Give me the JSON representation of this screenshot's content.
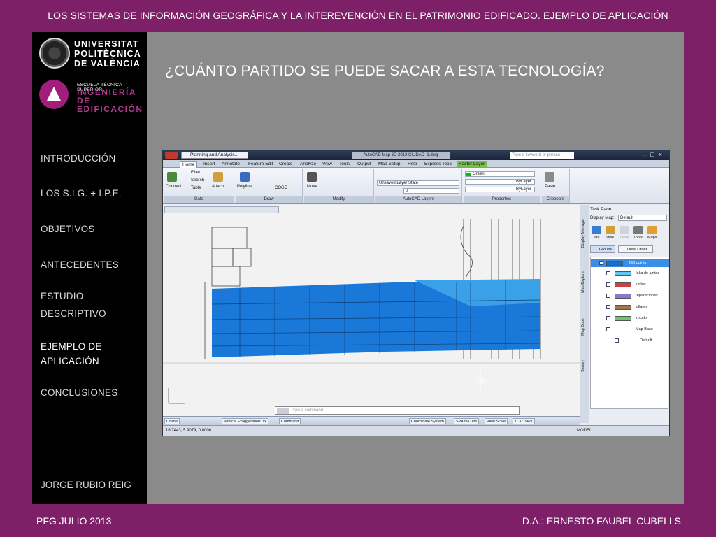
{
  "header": {
    "title": "LOS SISTEMAS DE INFORMACIÓN GEOGRÁFICA Y LA INTEREVENCIÓN EN EL PATRIMONIO EDIFICADO. EJEMPLO DE APLICACIÓN"
  },
  "footer": {
    "left": "PFG JULIO 2013",
    "right": "D.A.: ERNESTO FAUBEL CUBELLS"
  },
  "logos": {
    "upv": [
      "UNIVERSITAT",
      "POLITÈCNICA",
      "DE VALÈNCIA"
    ],
    "etsie_small": "ESCUELA TÉCNICA SUPERIOR",
    "etsie_big1": "INGENIERÍA DE",
    "etsie_big2": "EDIFICACIÓN"
  },
  "nav": {
    "items": [
      {
        "label": "INTRODUCCIÓN"
      },
      {
        "label": "LOS S.I.G. + I.P.E."
      },
      {
        "label": "OBJETIVOS"
      },
      {
        "label": "ANTECEDENTES"
      },
      {
        "label": "ESTUDIO"
      },
      {
        "label": "DESCRIPTIVO"
      },
      {
        "label": "EJEMPLO DE"
      },
      {
        "label": "APLICACIÓN"
      },
      {
        "label": "CONCLUSIONES"
      }
    ],
    "author": "JORGE RUBIO REIG"
  },
  "slide": {
    "heading": "¿CUÁNTO PARTIDO SE PUEDE SACAR A ESTA TECNOLOGÍA?"
  },
  "app": {
    "workspace": "Planning and Analysis...",
    "window_title": "AutoCAD Map 3D 2013  CIUDAD_1.dwg",
    "help_placeholder": "Type a keyword or phrase",
    "ribbon_tabs": [
      "Home",
      "Insert",
      "Annotate",
      "Feature Edit",
      "Create",
      "Analyze",
      "View",
      "Tools",
      "Output",
      "Map Setup",
      "Help",
      "Express Tools",
      "Raster Layer"
    ],
    "panels": {
      "data": {
        "label": "Data",
        "connect": "Connect",
        "filter": "Filter",
        "search": "Search",
        "table": "Table",
        "attach": "Attach"
      },
      "draw": {
        "label": "Draw",
        "polyline": "Polyline",
        "cogo": "COGO"
      },
      "modify": {
        "label": "Modify",
        "move": "Move"
      },
      "layers": {
        "label": "AutoCAD Layers",
        "state": "Unsaved Layer State",
        "layer": "0"
      },
      "properties": {
        "label": "Properties",
        "color": "Green",
        "lt1": "ByLayer",
        "lt2": "ByLayer"
      },
      "clipboard": {
        "label": "Clipboard",
        "paste": "Paste"
      }
    },
    "command_placeholder": "Type a command",
    "taskpane": {
      "title": "Task Pane",
      "display_map_label": "Display Map:",
      "display_map_value": "Default",
      "tools": [
        "Data",
        "Style",
        "Table",
        "Tools",
        "Maps"
      ],
      "subtabs": [
        "Groups",
        "Draw Order"
      ],
      "side_tabs": [
        "Display Manager",
        "Map Explorer",
        "Map Book",
        "Survey"
      ],
      "layers": [
        {
          "label": "298 points",
          "color": "#1f6fc4",
          "selected": true
        },
        {
          "label": "falta de juntas",
          "color": "#5ec8f0"
        },
        {
          "label": "juntas",
          "color": "#c84242"
        },
        {
          "label": "reparaciones",
          "color": "#8a78c8"
        },
        {
          "label": "sillares",
          "color": "#9a7a4a"
        },
        {
          "label": "zocalo",
          "color": "#6cc66c"
        },
        {
          "label": "Map Base"
        },
        {
          "label": "Default"
        }
      ]
    },
    "status": {
      "online": "Online",
      "vexag": "Vertical Exaggeration: 1x",
      "command": "Command",
      "coord_system": "Coordinate System",
      "cs_value": "SPAIN-UTM",
      "view_scale": "View Scale",
      "view_scale_value": "1: 37.3421",
      "coords": "16.7443, 5.9079, 0.0000",
      "model": "MODEL"
    },
    "colors": {
      "fill_blue": "#1a78d8",
      "light_blue": "#3aa0e8"
    }
  }
}
